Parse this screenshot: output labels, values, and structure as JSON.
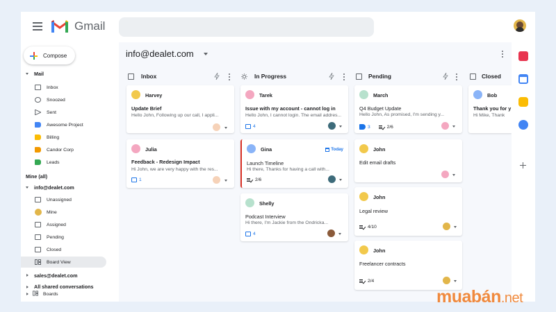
{
  "header": {
    "app_name": "Gmail",
    "search_placeholder": ""
  },
  "sidebar": {
    "compose_label": "Compose",
    "mail_section": "Mail",
    "mail_items": [
      {
        "label": "Inbox",
        "icon": "inbox-icon"
      },
      {
        "label": "Snoozed",
        "icon": "clock-icon"
      },
      {
        "label": "Sent",
        "icon": "send-icon"
      },
      {
        "label": "Awesome Project",
        "icon": "label-icon",
        "color": "#4285f4"
      },
      {
        "label": "Billing",
        "icon": "label-icon",
        "color": "#fbbc04"
      },
      {
        "label": "Candor Corp",
        "icon": "label-icon",
        "color": "#f29900"
      },
      {
        "label": "Leads",
        "icon": "label-icon",
        "color": "#34a853"
      }
    ],
    "mine_all": "Mine (all)",
    "account": "info@dealet.com",
    "account_items": [
      {
        "label": "Unassigned",
        "icon": "clipboard-icon"
      },
      {
        "label": "Mine",
        "icon": "avatar-icon"
      },
      {
        "label": "Assigned",
        "icon": "assigned-icon"
      },
      {
        "label": "Pending",
        "icon": "pending-icon"
      },
      {
        "label": "Closed",
        "icon": "closed-icon"
      },
      {
        "label": "Board View",
        "icon": "board-icon",
        "selected": true
      }
    ],
    "account2": "sales@dealet.com",
    "shared": "All shared conversations",
    "boards": "Boards"
  },
  "main": {
    "account_title": "info@dealet.com",
    "columns": [
      {
        "title": "Inbox",
        "icon": "inbox-icon",
        "cards": [
          {
            "name": "Harvey",
            "color": "#f2c94c",
            "subject": "Update Brief",
            "snippet": "Hello John, Following up our call, I appli..."
          },
          {
            "name": "Julia",
            "color": "#f4a7c0",
            "subject": "Feedback - Redesign Impact",
            "snippet": "Hi John, we are very happy with the res...",
            "comments": "1"
          }
        ]
      },
      {
        "title": "In Progress",
        "icon": "sun-icon",
        "cards": [
          {
            "name": "Tarek",
            "color": "#f4a7c0",
            "subject": "Issue with my account - cannot log in",
            "snippet": "Hello John, I cannot login. The email addres...",
            "comments": "4"
          },
          {
            "name": "Gina",
            "color": "#8ab4f8",
            "subject": "Launch Timeline",
            "snippet": "Hi there, Thanks for having a call with...",
            "tasks": "2/6",
            "today": "Today"
          },
          {
            "name": "Shelly",
            "color": "#b7e1cd",
            "subject": "Podcast Interview",
            "snippet": "Hi there, I'm Jackie from the Ondricka...",
            "comments": "4"
          }
        ]
      },
      {
        "title": "Pending",
        "icon": "clipboard-icon",
        "cards": [
          {
            "name": "March",
            "color": "#b7e1cd",
            "subject": "Q4 Budget Update",
            "snippet": "Hello John, As promised, I'm sending y...",
            "tags": "3",
            "tasks": "2/6"
          },
          {
            "name": "John",
            "color": "#f2c94c",
            "subject": "Edit email drafts"
          },
          {
            "name": "John",
            "color": "#f2c94c",
            "subject": "Legal review",
            "tasks": "4/10"
          },
          {
            "name": "John",
            "color": "#f2c94c",
            "subject": "Freelancer contracts",
            "tasks": "2/4"
          }
        ]
      },
      {
        "title": "Closed",
        "icon": "check-box-icon",
        "cards": [
          {
            "name": "Bob",
            "color": "#8ab4f8",
            "subject": "Thank you for y",
            "snippet": "Hi Mike, Thank"
          }
        ]
      }
    ]
  },
  "watermark": {
    "brand": "muabán",
    "suffix": ".net"
  },
  "colors": {
    "accent": "#1a73e8",
    "selected_bg": "#e8eaed",
    "in_progress_marker": "#d93025"
  }
}
